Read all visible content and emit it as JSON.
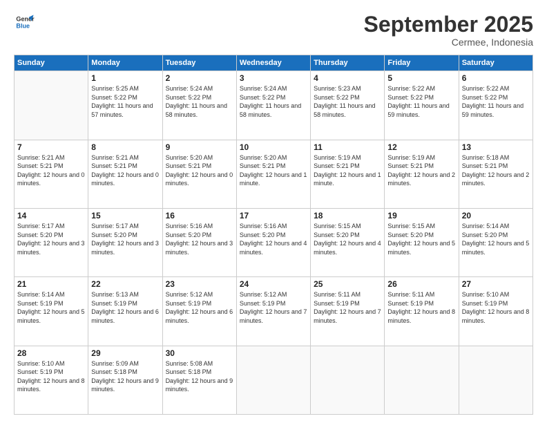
{
  "logo": {
    "line1": "General",
    "line2": "Blue"
  },
  "title": "September 2025",
  "subtitle": "Cermee, Indonesia",
  "days_header": [
    "Sunday",
    "Monday",
    "Tuesday",
    "Wednesday",
    "Thursday",
    "Friday",
    "Saturday"
  ],
  "weeks": [
    [
      {
        "day": "",
        "info": ""
      },
      {
        "day": "1",
        "info": "Sunrise: 5:25 AM\nSunset: 5:22 PM\nDaylight: 11 hours\nand 57 minutes."
      },
      {
        "day": "2",
        "info": "Sunrise: 5:24 AM\nSunset: 5:22 PM\nDaylight: 11 hours\nand 58 minutes."
      },
      {
        "day": "3",
        "info": "Sunrise: 5:24 AM\nSunset: 5:22 PM\nDaylight: 11 hours\nand 58 minutes."
      },
      {
        "day": "4",
        "info": "Sunrise: 5:23 AM\nSunset: 5:22 PM\nDaylight: 11 hours\nand 58 minutes."
      },
      {
        "day": "5",
        "info": "Sunrise: 5:22 AM\nSunset: 5:22 PM\nDaylight: 11 hours\nand 59 minutes."
      },
      {
        "day": "6",
        "info": "Sunrise: 5:22 AM\nSunset: 5:22 PM\nDaylight: 11 hours\nand 59 minutes."
      }
    ],
    [
      {
        "day": "7",
        "info": "Sunrise: 5:21 AM\nSunset: 5:21 PM\nDaylight: 12 hours\nand 0 minutes."
      },
      {
        "day": "8",
        "info": "Sunrise: 5:21 AM\nSunset: 5:21 PM\nDaylight: 12 hours\nand 0 minutes."
      },
      {
        "day": "9",
        "info": "Sunrise: 5:20 AM\nSunset: 5:21 PM\nDaylight: 12 hours\nand 0 minutes."
      },
      {
        "day": "10",
        "info": "Sunrise: 5:20 AM\nSunset: 5:21 PM\nDaylight: 12 hours\nand 1 minute."
      },
      {
        "day": "11",
        "info": "Sunrise: 5:19 AM\nSunset: 5:21 PM\nDaylight: 12 hours\nand 1 minute."
      },
      {
        "day": "12",
        "info": "Sunrise: 5:19 AM\nSunset: 5:21 PM\nDaylight: 12 hours\nand 2 minutes."
      },
      {
        "day": "13",
        "info": "Sunrise: 5:18 AM\nSunset: 5:21 PM\nDaylight: 12 hours\nand 2 minutes."
      }
    ],
    [
      {
        "day": "14",
        "info": "Sunrise: 5:17 AM\nSunset: 5:20 PM\nDaylight: 12 hours\nand 3 minutes."
      },
      {
        "day": "15",
        "info": "Sunrise: 5:17 AM\nSunset: 5:20 PM\nDaylight: 12 hours\nand 3 minutes."
      },
      {
        "day": "16",
        "info": "Sunrise: 5:16 AM\nSunset: 5:20 PM\nDaylight: 12 hours\nand 3 minutes."
      },
      {
        "day": "17",
        "info": "Sunrise: 5:16 AM\nSunset: 5:20 PM\nDaylight: 12 hours\nand 4 minutes."
      },
      {
        "day": "18",
        "info": "Sunrise: 5:15 AM\nSunset: 5:20 PM\nDaylight: 12 hours\nand 4 minutes."
      },
      {
        "day": "19",
        "info": "Sunrise: 5:15 AM\nSunset: 5:20 PM\nDaylight: 12 hours\nand 5 minutes."
      },
      {
        "day": "20",
        "info": "Sunrise: 5:14 AM\nSunset: 5:20 PM\nDaylight: 12 hours\nand 5 minutes."
      }
    ],
    [
      {
        "day": "21",
        "info": "Sunrise: 5:14 AM\nSunset: 5:19 PM\nDaylight: 12 hours\nand 5 minutes."
      },
      {
        "day": "22",
        "info": "Sunrise: 5:13 AM\nSunset: 5:19 PM\nDaylight: 12 hours\nand 6 minutes."
      },
      {
        "day": "23",
        "info": "Sunrise: 5:12 AM\nSunset: 5:19 PM\nDaylight: 12 hours\nand 6 minutes."
      },
      {
        "day": "24",
        "info": "Sunrise: 5:12 AM\nSunset: 5:19 PM\nDaylight: 12 hours\nand 7 minutes."
      },
      {
        "day": "25",
        "info": "Sunrise: 5:11 AM\nSunset: 5:19 PM\nDaylight: 12 hours\nand 7 minutes."
      },
      {
        "day": "26",
        "info": "Sunrise: 5:11 AM\nSunset: 5:19 PM\nDaylight: 12 hours\nand 8 minutes."
      },
      {
        "day": "27",
        "info": "Sunrise: 5:10 AM\nSunset: 5:19 PM\nDaylight: 12 hours\nand 8 minutes."
      }
    ],
    [
      {
        "day": "28",
        "info": "Sunrise: 5:10 AM\nSunset: 5:19 PM\nDaylight: 12 hours\nand 8 minutes."
      },
      {
        "day": "29",
        "info": "Sunrise: 5:09 AM\nSunset: 5:18 PM\nDaylight: 12 hours\nand 9 minutes."
      },
      {
        "day": "30",
        "info": "Sunrise: 5:08 AM\nSunset: 5:18 PM\nDaylight: 12 hours\nand 9 minutes."
      },
      {
        "day": "",
        "info": ""
      },
      {
        "day": "",
        "info": ""
      },
      {
        "day": "",
        "info": ""
      },
      {
        "day": "",
        "info": ""
      }
    ]
  ]
}
